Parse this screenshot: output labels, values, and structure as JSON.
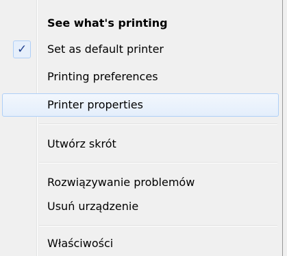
{
  "context_menu": {
    "items": [
      {
        "label": "See what's printing",
        "bold": true
      },
      {
        "label": "Set as default printer",
        "checked": true
      },
      {
        "label": "Printing preferences"
      },
      {
        "label": "Printer properties",
        "highlighted": true
      },
      {
        "label": "Utwórz skrót"
      },
      {
        "label": "Rozwiązywanie problemów"
      },
      {
        "label": "Usuń urządzenie"
      },
      {
        "label": "Właściwości"
      }
    ],
    "check_glyph": "✓",
    "colors": {
      "background": "#f0f0f0",
      "highlight_border": "#aecff7",
      "highlight_fill": "#e4eefb",
      "check_color": "#1f3f8e"
    }
  }
}
